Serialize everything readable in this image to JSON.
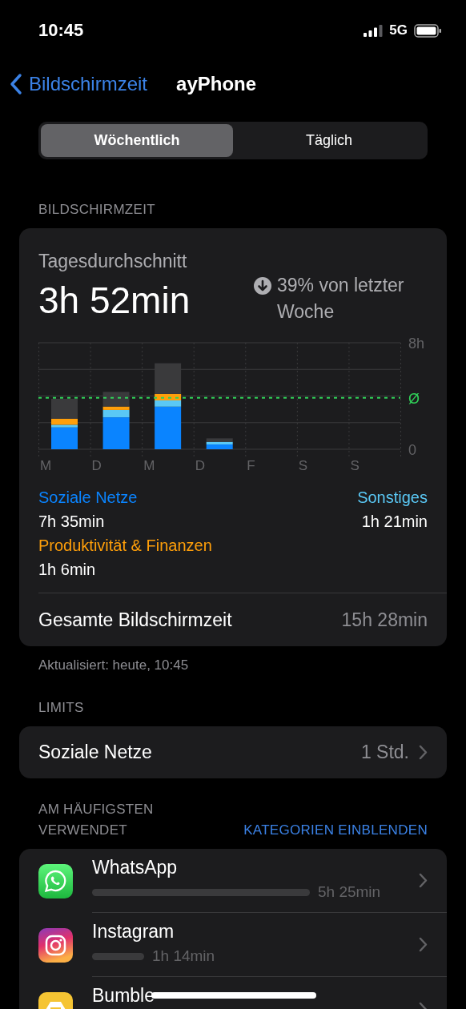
{
  "status_bar": {
    "time": "10:45",
    "network": "5G"
  },
  "nav": {
    "back": "Bildschirmzeit",
    "title": "ayPhone"
  },
  "segments": [
    {
      "label": "Wöchentlich",
      "selected": true
    },
    {
      "label": "Täglich",
      "selected": false
    }
  ],
  "screen_time": {
    "header": "BILDSCHIRMZEIT",
    "avg_label": "Tagesdurchschnitt",
    "avg_value": "3h 52min",
    "change": "39% von letzter Woche",
    "chart_data": {
      "type": "bar",
      "stacked": true,
      "categories": [
        "M",
        "D",
        "M",
        "D",
        "F",
        "S",
        "S"
      ],
      "ylim": [
        0,
        8
      ],
      "yticks": [
        {
          "value": 0,
          "label": "0"
        },
        {
          "value": 8,
          "label": "8h"
        }
      ],
      "series": [
        {
          "name": "Soziale Netze",
          "color": "#0a84ff",
          "values": [
            1.64,
            2.4,
            3.2,
            0.36,
            null,
            null,
            null
          ]
        },
        {
          "name": "Sonstiges",
          "color": "#5ac8f5",
          "values": [
            0.2,
            0.55,
            0.47,
            0.2,
            null,
            null,
            null
          ]
        },
        {
          "name": "Produktivität & Finanzen",
          "color": "#ff9f0a",
          "values": [
            0.45,
            0.26,
            0.49,
            0,
            null,
            null,
            null
          ]
        },
        {
          "color": "#3a3a3c",
          "values": [
            1.5,
            1.1,
            2.3,
            0.26,
            null,
            null,
            null
          ]
        }
      ],
      "ref_lines": [
        {
          "axis": "y",
          "value": 3.87,
          "label": "Ø",
          "color": "#30d158"
        }
      ]
    },
    "legend": [
      {
        "time": "7h 35min"
      },
      {
        "time": "1h 21min"
      },
      {
        "time": "1h 6min"
      }
    ],
    "total_label": "Gesamte Bildschirmzeit",
    "total_value": "15h 28min",
    "updated": "Aktualisiert: heute, 10:45"
  },
  "limits": {
    "header": "LIMITS",
    "items": [
      {
        "name": "Soziale Netze",
        "value": "1 Std."
      }
    ]
  },
  "most_used": {
    "header": "AM HÄUFIGSTEN VERWENDET",
    "action": "KATEGORIEN EINBLENDEN",
    "apps": [
      {
        "name": "WhatsApp",
        "time": "5h 25min",
        "kind": "whatsapp"
      },
      {
        "name": "Instagram",
        "time": "1h 14min",
        "kind": "instagram"
      },
      {
        "name": "Bumble",
        "kind": "bumble"
      }
    ]
  }
}
